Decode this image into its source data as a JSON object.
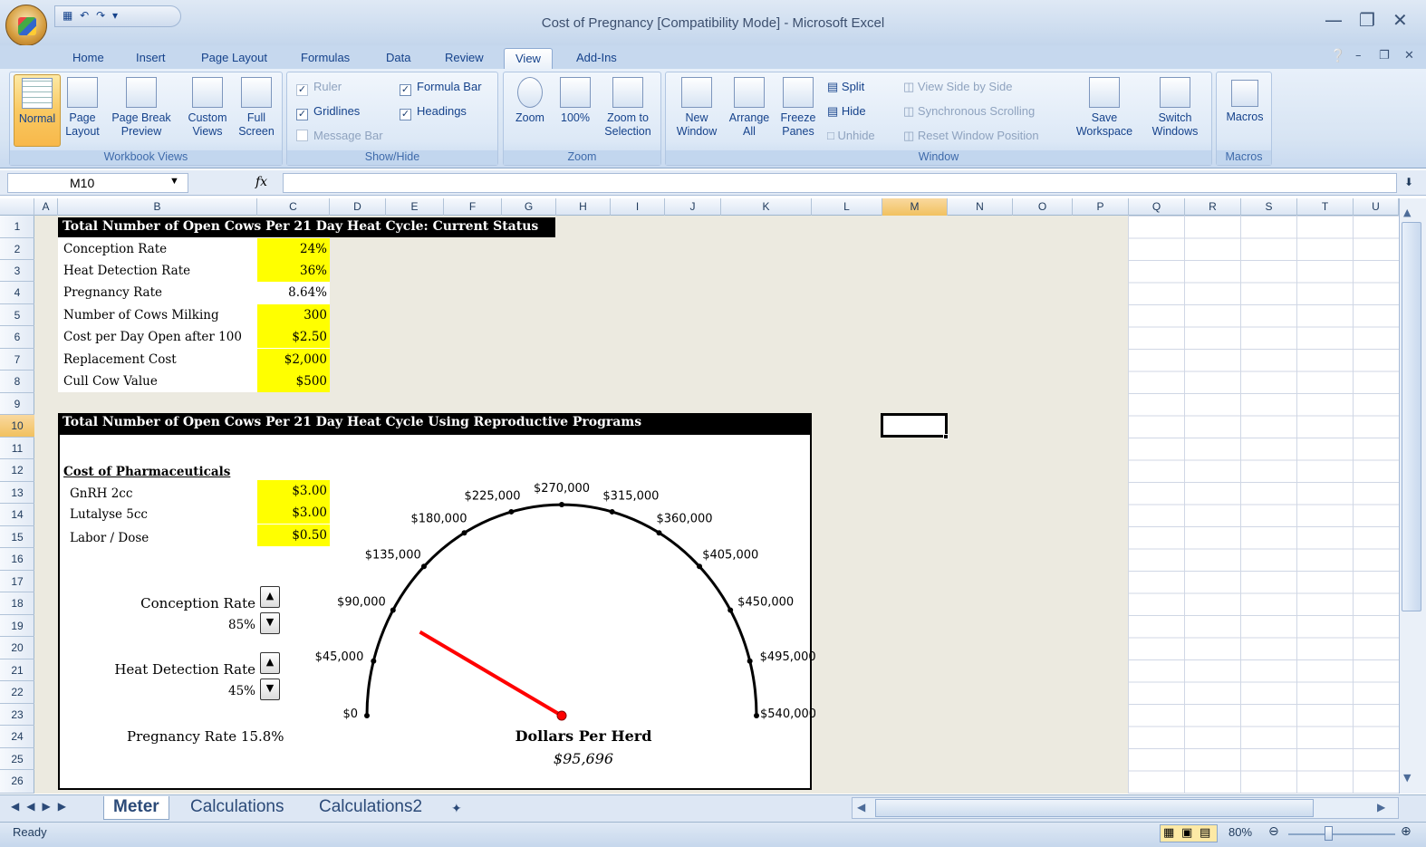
{
  "app": {
    "title": "Cost of Pregnancy  [Compatibility Mode] - Microsoft Excel"
  },
  "tabs": [
    "Home",
    "Insert",
    "Page Layout",
    "Formulas",
    "Data",
    "Review",
    "View",
    "Add-Ins"
  ],
  "ribbon": {
    "workbook_views": {
      "label": "Workbook Views",
      "normal": "Normal",
      "page_layout": "Page Layout",
      "page_break_preview": "Page Break Preview",
      "custom_views": "Custom Views",
      "full_screen": "Full Screen"
    },
    "show_hide": {
      "label": "Show/Hide",
      "ruler": "Ruler",
      "gridlines": "Gridlines",
      "message_bar": "Message Bar",
      "formula_bar": "Formula Bar",
      "headings": "Headings"
    },
    "zoom": {
      "label": "Zoom",
      "zoom": "Zoom",
      "hundred": "100%",
      "zoom_to_selection": "Zoom to Selection"
    },
    "window": {
      "label": "Window",
      "new_window": "New Window",
      "arrange_all": "Arrange All",
      "freeze_panes": "Freeze Panes",
      "split": "Split",
      "hide": "Hide",
      "unhide": "Unhide",
      "side_by_side": "View Side by Side",
      "sync_scroll": "Synchronous Scrolling",
      "reset_pos": "Reset Window Position",
      "save_workspace": "Save Workspace",
      "switch_windows": "Switch Windows"
    },
    "macros": {
      "label": "Macros",
      "macros": "Macros"
    }
  },
  "formula_bar": {
    "name_box": "M10",
    "fx": "fx",
    "content": ""
  },
  "columns": [
    "A",
    "B",
    "C",
    "D",
    "E",
    "F",
    "G",
    "H",
    "I",
    "J",
    "K",
    "L",
    "M",
    "N",
    "O",
    "P",
    "Q",
    "R",
    "S",
    "T",
    "U"
  ],
  "rows": [
    "1",
    "2",
    "3",
    "4",
    "5",
    "6",
    "7",
    "8",
    "9",
    "10",
    "11",
    "12",
    "13",
    "14",
    "15",
    "16",
    "17",
    "18",
    "19",
    "20",
    "21",
    "22",
    "23",
    "24",
    "25",
    "26"
  ],
  "sheet": {
    "section1_title": "Total Number of Open Cows Per 21 Day Heat Cycle: Current Status",
    "rows1": [
      {
        "label": "Conception Rate",
        "value": "24%"
      },
      {
        "label": "Heat Detection Rate",
        "value": "36%"
      },
      {
        "label": "Pregnancy Rate",
        "value": "8.64%"
      },
      {
        "label": "Number of Cows Milking",
        "value": "300"
      },
      {
        "label": "Cost per Day Open after 100",
        "value": "$2.50"
      },
      {
        "label": "Replacement Cost",
        "value": "$2,000"
      },
      {
        "label": "Cull Cow Value",
        "value": "$500"
      }
    ],
    "section2_title": "Total Number of Open Cows Per 21 Day Heat Cycle Using Reproductive Programs",
    "pharma_title": "Cost of Pharmaceuticals",
    "pharma": [
      {
        "label": "GnRH 2cc",
        "value": "$3.00"
      },
      {
        "label": "Lutalyse 5cc",
        "value": "$3.00"
      },
      {
        "label": "Labor / Dose",
        "value": "$0.50"
      }
    ],
    "conception_label": "Conception Rate",
    "conception_value": "85%",
    "heat_label": "Heat Detection Rate",
    "heat_value": "45%",
    "pregnancy_label": "Pregnancy Rate 15.8%",
    "gauge_title": "Dollars Per Herd",
    "gauge_value": "$95,696"
  },
  "chart_data": {
    "type": "gauge",
    "title": "Dollars Per Herd",
    "min": 0,
    "max": 540000,
    "ticks": [
      "$0",
      "$45,000",
      "$90,000",
      "$135,000",
      "$180,000",
      "$225,000",
      "$270,000",
      "$315,000",
      "$360,000",
      "$405,000",
      "$450,000",
      "$495,000",
      "$540,000"
    ],
    "value": 95696,
    "needle_color": "#ff0000"
  },
  "sheet_tabs": [
    "Meter",
    "Calculations",
    "Calculations2"
  ],
  "status": {
    "ready": "Ready",
    "zoom": "80%"
  }
}
